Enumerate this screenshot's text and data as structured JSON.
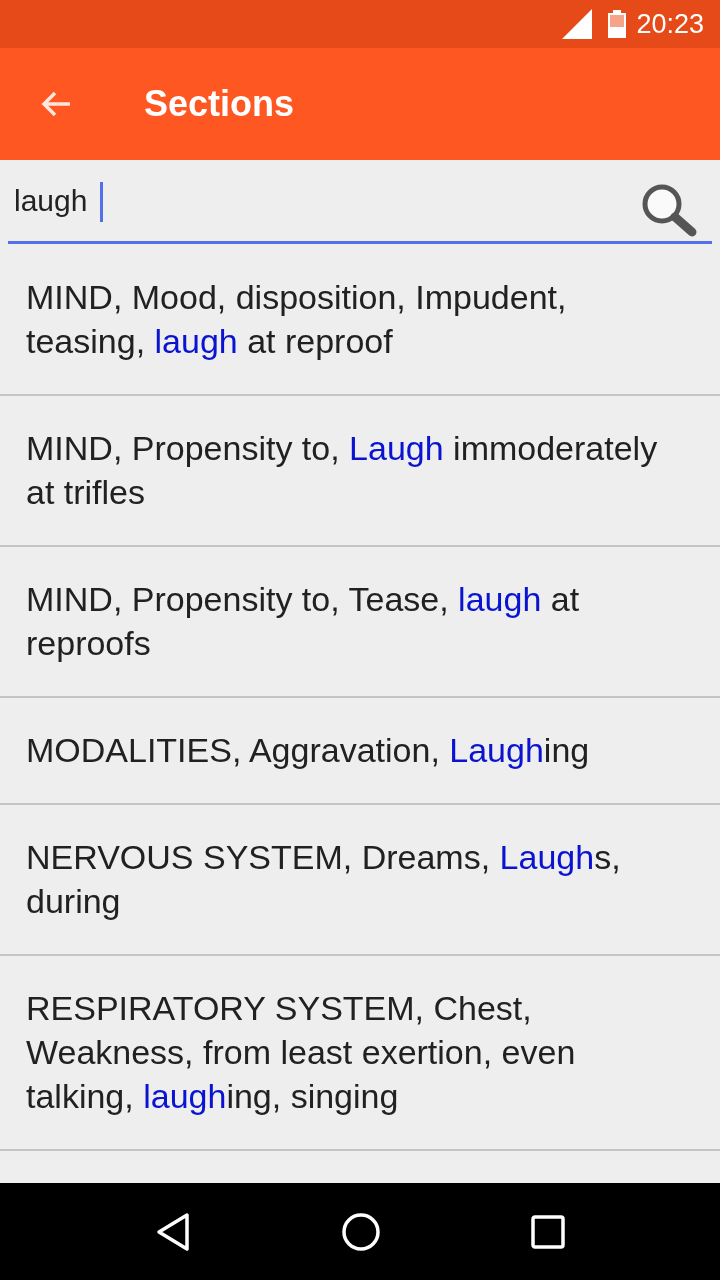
{
  "status_bar": {
    "time": "20:23"
  },
  "toolbar": {
    "title": "Sections"
  },
  "search": {
    "value": "laugh"
  },
  "results": [
    {
      "segments": [
        {
          "text": "MIND, Mood, disposition, Impudent, teasing, ",
          "match": false
        },
        {
          "text": "laugh",
          "match": true
        },
        {
          "text": " at reproof",
          "match": false
        }
      ]
    },
    {
      "segments": [
        {
          "text": "MIND, Propensity to, ",
          "match": false
        },
        {
          "text": "Laugh",
          "match": true
        },
        {
          "text": " immoderately at trifles",
          "match": false
        }
      ]
    },
    {
      "segments": [
        {
          "text": "MIND, Propensity to, Tease, ",
          "match": false
        },
        {
          "text": "laugh",
          "match": true
        },
        {
          "text": " at reproofs",
          "match": false
        }
      ]
    },
    {
      "segments": [
        {
          "text": "MODALITIES, Aggravation, ",
          "match": false
        },
        {
          "text": "Laugh",
          "match": true
        },
        {
          "text": "ing",
          "match": false
        }
      ]
    },
    {
      "segments": [
        {
          "text": "NERVOUS SYSTEM, Dreams, ",
          "match": false
        },
        {
          "text": "Laugh",
          "match": true
        },
        {
          "text": "s, during",
          "match": false
        }
      ]
    },
    {
      "segments": [
        {
          "text": "RESPIRATORY SYSTEM, Chest, Weakness, from least exertion, even talking, ",
          "match": false
        },
        {
          "text": "laugh",
          "match": true
        },
        {
          "text": "ing, singing",
          "match": false
        }
      ]
    }
  ]
}
